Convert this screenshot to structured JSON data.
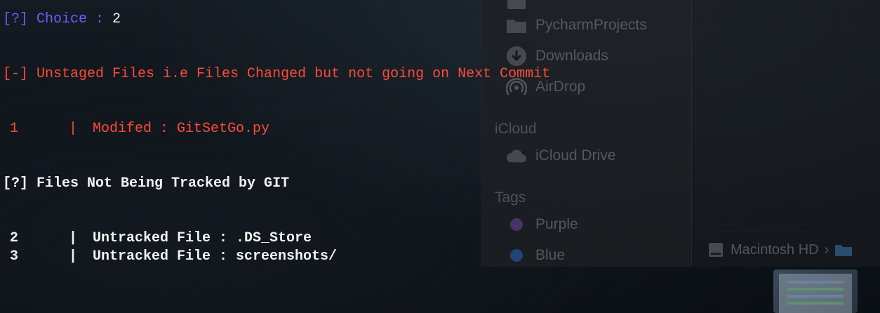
{
  "finder": {
    "favorites": [
      {
        "label": "PycharmProjects",
        "icon": "folder-icon"
      },
      {
        "label": "Downloads",
        "icon": "download-icon"
      },
      {
        "label": "AirDrop",
        "icon": "airdrop-icon"
      }
    ],
    "icloud_label": "iCloud",
    "icloud_drive_label": "iCloud Drive",
    "tags_label": "Tags",
    "tags": [
      {
        "label": "Purple",
        "color": "#7b4fb0"
      },
      {
        "label": "Blue",
        "color": "#2f73d6"
      }
    ],
    "path_root": "Macintosh HD",
    "path_sep": "›"
  },
  "terminal": {
    "choice_prompt": "[?] Choice : ",
    "choice_value": "2",
    "unstaged_header": "[-] Unstaged Files i.e Files Changed but not going on Next Commit",
    "unstaged": [
      {
        "num": "1",
        "sep": "|",
        "text": "Modifed : GitSetGo.py"
      }
    ],
    "untracked_header": "[?] Files Not Being Tracked by GIT",
    "untracked": [
      {
        "num": "2",
        "sep": "|",
        "text": "Untracked File : .DS_Store"
      },
      {
        "num": "3",
        "sep": "|",
        "text": "Untracked File : screenshots/"
      }
    ]
  },
  "colors": {
    "prompt_blue": "#6f5dff",
    "error_red": "#ff4a3a",
    "text_white": "#f2f2f2"
  }
}
